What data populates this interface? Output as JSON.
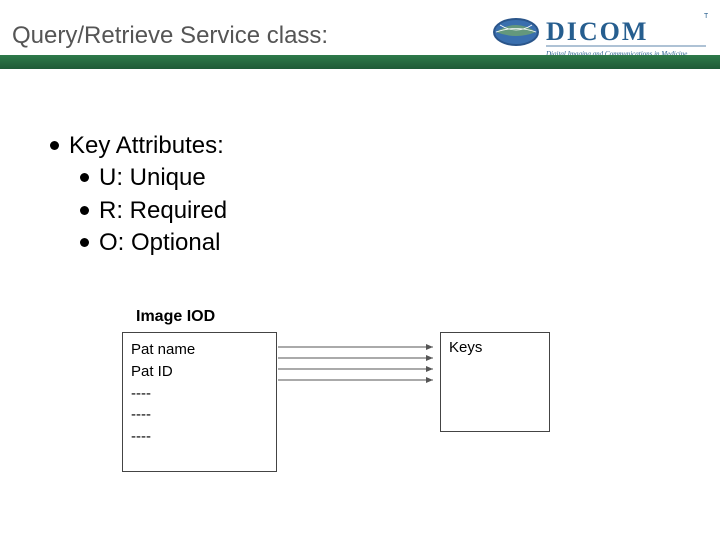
{
  "header": {
    "title": "Query/Retrieve Service class:",
    "logo_main": "DICOM",
    "logo_sub": "Digital Imaging and Communications in Medicine"
  },
  "bullets": {
    "main": "Key Attributes:",
    "u": "U: Unique",
    "r": "R: Required",
    "o": "O: Optional"
  },
  "diagram": {
    "iod_label": "Image IOD",
    "iod_box": {
      "line1": "Pat name",
      "line2": "Pat ID",
      "line3": "----",
      "line4": "----",
      "line5": "----"
    },
    "keys_box": {
      "title": "Keys"
    }
  }
}
